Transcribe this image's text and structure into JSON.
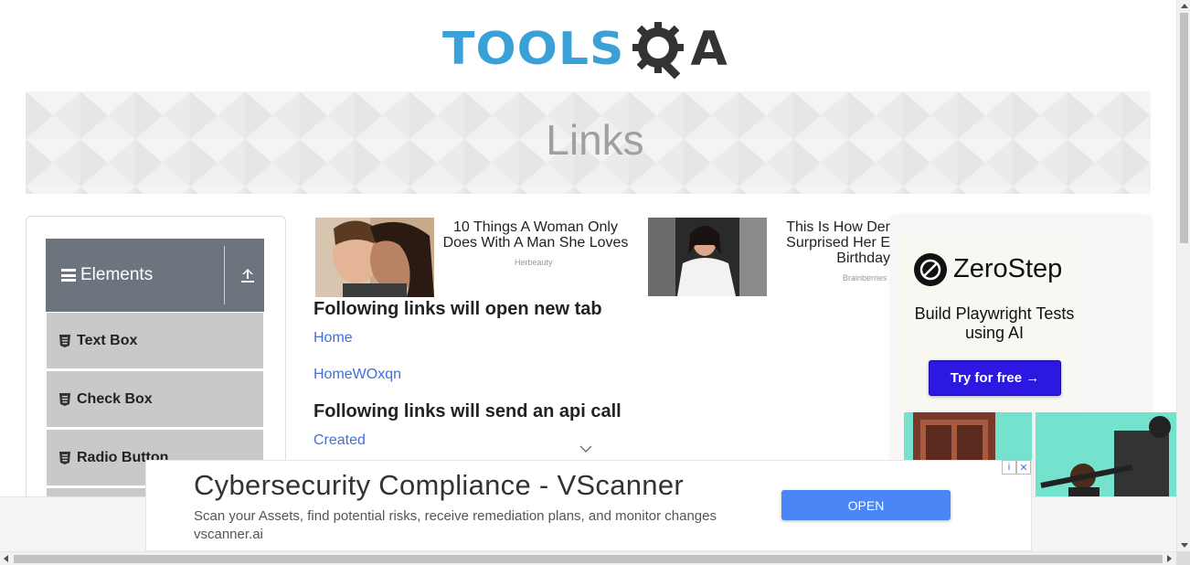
{
  "header": {
    "logo_tools": "TOOLS",
    "logo_a": "A"
  },
  "banner": {
    "title": "Links"
  },
  "sidebar": {
    "group_label": "Elements",
    "items": [
      {
        "label": "Text Box"
      },
      {
        "label": "Check Box"
      },
      {
        "label": "Radio Button"
      }
    ]
  },
  "top_ads": [
    {
      "title": "10 Things A Woman Only Does With A Man She Loves",
      "source": "Herbeauty"
    },
    {
      "title": "This Is How Der Surprised Her E Birthday",
      "source": "Brainberries"
    }
  ],
  "main": {
    "new_tab_heading": "Following links will open new tab",
    "new_tab_links": [
      "Home",
      "HomeWOxqn"
    ],
    "api_heading": "Following links will send an api call",
    "api_links": [
      "Created"
    ]
  },
  "right_ad": {
    "brand": "ZeroStep",
    "description": "Build Playwright Tests using AI",
    "cta": "Try for free →"
  },
  "bottom_ad": {
    "title": "Cybersecurity Compliance - VScanner",
    "description": "Scan your Assets, find potential risks, receive remediation plans, and monitor changes",
    "url": "vscanner.ai",
    "cta": "OPEN",
    "adchoices_info": "i",
    "adchoices_close": "✕"
  },
  "colors": {
    "accent_link": "#3f6fd8",
    "sidebar_header": "#6c757d",
    "logo_blue": "#3aa0d8",
    "zerostep_button": "#2c18e0",
    "vscanner_button": "#4a86f5"
  }
}
